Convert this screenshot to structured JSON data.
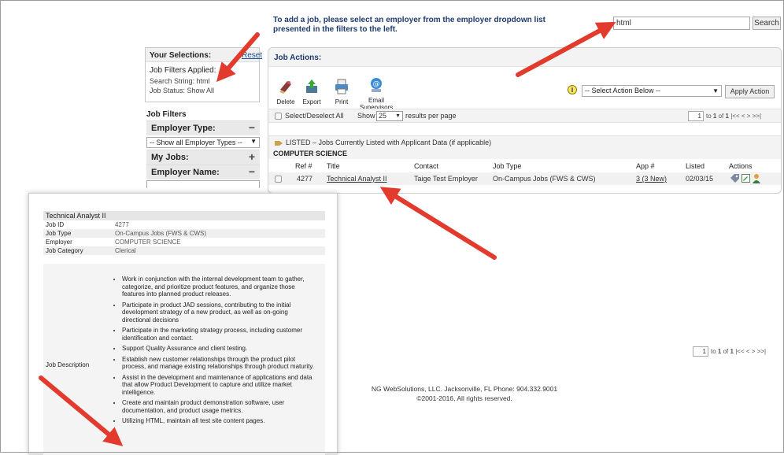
{
  "notice": {
    "line1": "To add a job, please select an employer from the employer dropdown list",
    "line2": "presented in the filters to the left."
  },
  "search": {
    "value": "html",
    "button": "Search"
  },
  "selections": {
    "title": "Your Selections:",
    "reset": "Reset",
    "applied_label": "Job Filters Applied:",
    "search_string": "Search String: html",
    "job_status": "Job Status: Show All"
  },
  "filters": {
    "title": "Job Filters",
    "employer_type": {
      "label": "Employer Type:",
      "sign": "−",
      "selected": "-- Show all Employer Types --"
    },
    "my_jobs": {
      "label": "My Jobs:",
      "sign": "+"
    },
    "employer_name": {
      "label": "Employer Name:",
      "sign": "−"
    }
  },
  "job_actions": {
    "title": "Job Actions:",
    "tools": [
      {
        "icon": "delete-icon",
        "label": "Delete"
      },
      {
        "icon": "export-icon",
        "label": "Export"
      },
      {
        "icon": "print-icon",
        "label": "Print"
      },
      {
        "icon": "email-icon",
        "label": "Email",
        "label2": "Supervisors"
      }
    ],
    "info_glyph": "i",
    "action_select": "-- Select Action Below --",
    "apply_button": "Apply Action",
    "select_all": "Select/Deselect All",
    "show_label": "Show",
    "per_page": "25",
    "per_page_suffix": "results per page",
    "pager": {
      "page": "1",
      "text_to": "to",
      "bold_one": "1",
      "of": "of",
      "bold_total": "1",
      "nav": "|<<  <  >  >>|"
    }
  },
  "listing": {
    "section_title": "LISTED – Jobs Currently Listed with Applicant Data (if applicable)",
    "employer": "COMPUTER SCIENCE",
    "headers": [
      "Ref #",
      "Title",
      "Contact",
      "Job Type",
      "App #",
      "Listed",
      "Actions"
    ],
    "rows": [
      {
        "ref": "4277",
        "title": "Technical Analyst II",
        "contact": "Taige Test Employer",
        "job_type": "On-Campus Jobs (FWS & CWS)",
        "app": "3 (3 New)",
        "listed": "02/03/15"
      }
    ]
  },
  "popup": {
    "title": "Technical Analyst II",
    "fields": [
      {
        "k": "Job ID",
        "v": "4277"
      },
      {
        "k": "Job Type",
        "v": "On-Campus Jobs (FWS & CWS)"
      },
      {
        "k": "Employer",
        "v": "COMPUTER SCIENCE"
      },
      {
        "k": "Job Category",
        "v": "Clerical"
      }
    ],
    "desc_label": "Job Description",
    "bullets": [
      "Work in conjunction with the internal development team to gather, categorize, and prioritize product features, and organize those features into planned product releases.",
      "Participate in product JAD sessions, contributing to the initial development strategy of a new product, as well as on-going directional decisions",
      "Participate in the marketing strategy process, including customer identification and contact.",
      "Support Quality Assurance and client testing.",
      "Establish new customer relationships through the product pilot process, and manage existing relationships through product maturity.",
      "Assist in the development and maintenance of applications and data that allow Product Development to capture and utilize market intelligence.",
      "Create and maintain product demonstration software, user documentation, and product usage metrics.",
      "Utilizing HTML, maintain all test site content pages."
    ]
  },
  "bottom_pager": {
    "page": "1",
    "text_to": "to",
    "bold_one": "1",
    "of": "of",
    "bold_total": "1",
    "nav": "|<<  <  >  >>|"
  },
  "footer": {
    "line1": "NG WebSolutions, LLC. Jacksonville, FL Phone: 904.332.9001",
    "line2": "©2001-2016,  All rights reserved."
  },
  "colors": {
    "arrow": "#e23b2e",
    "link": "#1a4f9a",
    "heading": "#1f3a6e"
  }
}
